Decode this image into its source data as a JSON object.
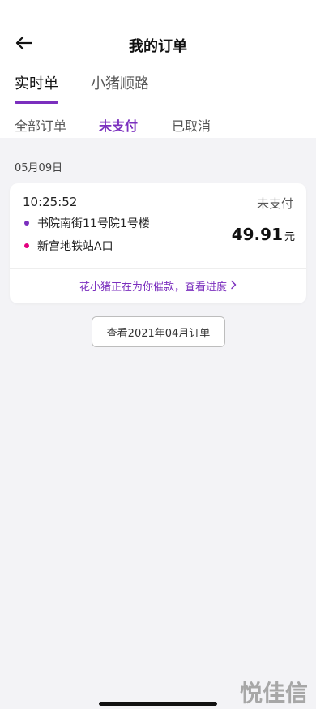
{
  "header": {
    "title": "我的订单",
    "tabs": [
      {
        "label": "实时单",
        "active": true
      },
      {
        "label": "小猪顺路",
        "active": false
      }
    ],
    "filters": [
      {
        "label": "全部订单",
        "active": false
      },
      {
        "label": "未支付",
        "active": true
      },
      {
        "label": "已取消",
        "active": false
      }
    ]
  },
  "main": {
    "date": "05月09日",
    "order": {
      "time": "10:25:52",
      "status": "未支付",
      "from": "书院南街11号院1号楼",
      "to": "新宫地铁站A口",
      "price": "49.91",
      "unit": "元",
      "urge_text": "花小猪正在为你催款，查看进度"
    },
    "history_button": "查看2021年04月订单"
  },
  "watermark": "悦佳信",
  "colors": {
    "accent": "#7b2fbe",
    "from_dot": "#7b2fbe",
    "to_dot": "#e3007f",
    "background": "#f3f3f6"
  },
  "icons": {
    "back": "arrow-left-icon",
    "urge_chevron": "chevron-right-icon"
  }
}
